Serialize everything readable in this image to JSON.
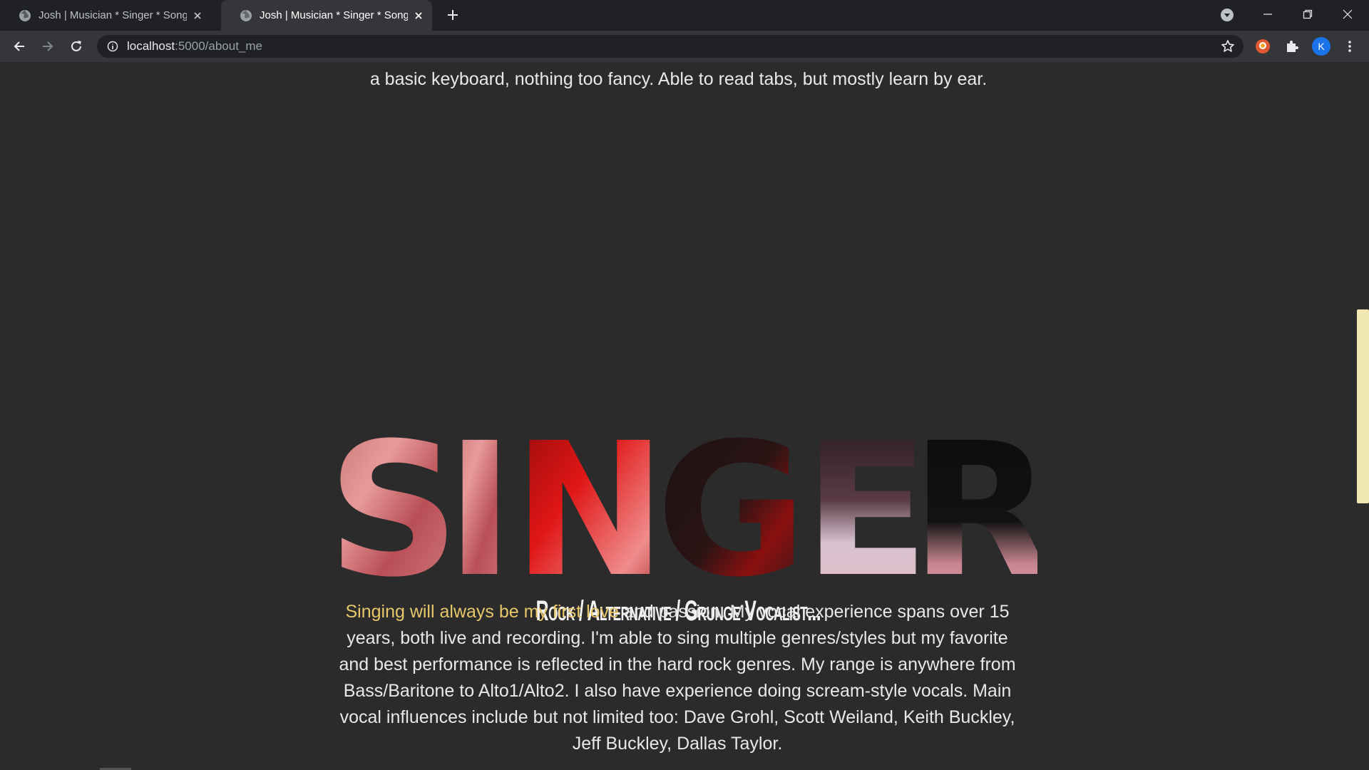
{
  "browser": {
    "tabs": [
      {
        "title": "Josh | Musician * Singer * Songwriter",
        "active": false
      },
      {
        "title": "Josh | Musician * Singer * Songwriter",
        "active": true
      }
    ],
    "url_host": "localhost",
    "url_path": ":5000/about_me",
    "profile_initial": "K"
  },
  "page": {
    "top_paragraph_tail": "a basic keyboard, nothing too fancy. Able to read tabs, but mostly learn by ear.",
    "singer_title": "SINGER",
    "subheading": "Rock / Alternative / Grunge Vocalist...",
    "main_paragraph": {
      "highlight": "Singing will always be my first love",
      "rest": " and passion. My vocal experience spans over 15 years, both live and recording. I'm able to sing multiple genres/styles but my favorite and best performance is reflected in the hard rock genres. My range is anywhere from Bass/Baritone to Alto1/Alto2. I also have experience doing scream-style vocals. Main vocal influences include but not limited too: Dave Grohl, Scott Weiland, Keith Buckley, Jeff Buckley, Dallas Taylor."
    }
  },
  "colors": {
    "background": "#2b2b2b",
    "highlight": "#e6c76a",
    "text": "#e8e8e8",
    "scroll_thumb": "#f0e7b2"
  },
  "icons": [
    "globe-icon",
    "close-icon",
    "plus-icon",
    "tab-search-icon",
    "minimize-icon",
    "restore-icon",
    "back-icon",
    "forward-icon",
    "reload-icon",
    "info-icon",
    "star-icon",
    "extension-icon",
    "puzzle-icon"
  ]
}
